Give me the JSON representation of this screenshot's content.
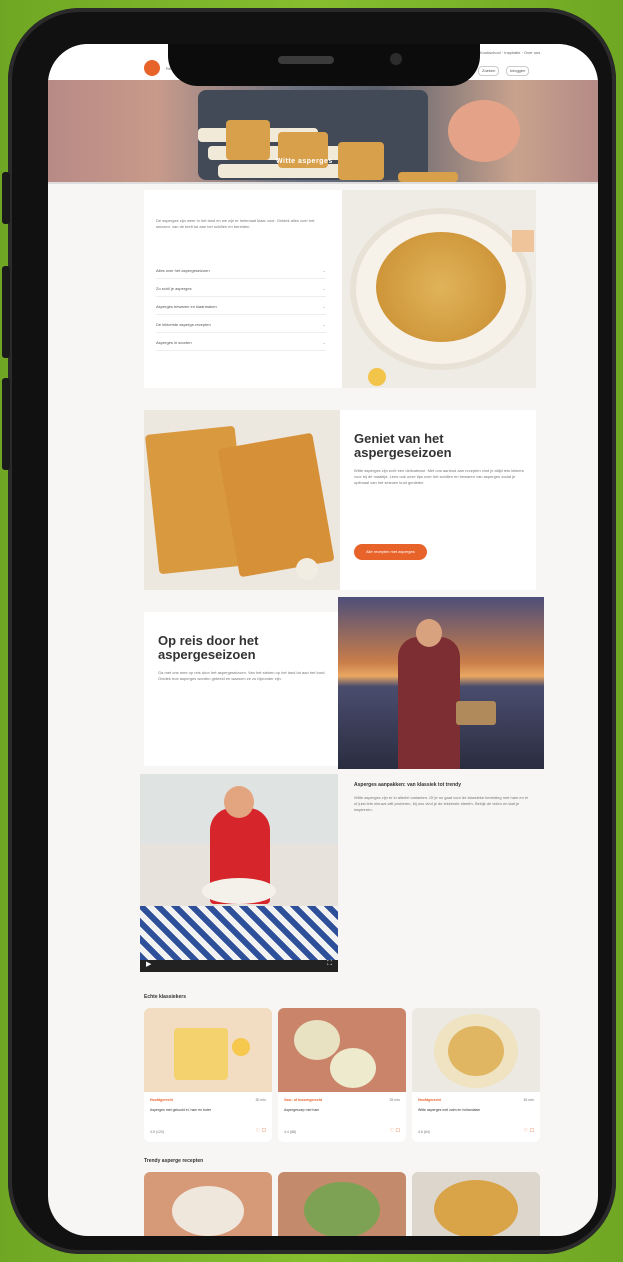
{
  "header": {
    "nav_left": "Recepten",
    "nav_right": "Kookschool · Inspiratie · Over ons",
    "search": "Zoeken",
    "account": "Inloggen"
  },
  "hero": {
    "title": "Witte asperges"
  },
  "intro": {
    "text": "De asperges zijn weer in het land en we zijn er helemaal klaar voor. Ontdek alles over het seizoen, van de teelt tot aan het schillen en bereiden.",
    "accordion": [
      "Alles over het aspergeseizoen",
      "Zo schil je asperges",
      "Asperges bewaren en klaarmaken",
      "De lekkerste asperge-recepten",
      "Asperges in soorten"
    ]
  },
  "section_geniet": {
    "title": "Geniet van het aspergeseizoen",
    "text": "Witte asperges zijn echt een delicatesse. Met ons aanbod aan recepten vind je altijd iets lekkers voor bij de maaltijd. Lees ook onze tips over het schillen en bewaren van asperges zodat je optimaal van het seizoen kunt genieten.",
    "button": "Alle recepten met asperges"
  },
  "section_reis": {
    "title": "Op reis door het aspergeseizoen",
    "text": "Ga met ons mee op reis door het aspergeseizoen. Van het steken op het land tot aan het bord. Ontdek hoe asperges worden geteeld en waarom ze zo bijzonder zijn."
  },
  "section_video": {
    "title": "Asperges aanpakken: van klassiek tot trendy",
    "text": "Witte asperges zijn er in allerlei varianten. Of je nu gaat voor de klassieke bereiding met ham en ei of juist iets nieuws wilt proberen, bij ons vind je de lekkerste ideeën. Bekijk de video en laat je inspireren."
  },
  "classics": {
    "title": "Echte klassiekers",
    "recipes": [
      {
        "tag": "Hoofdgerecht",
        "time": "30 min",
        "name": "Asperges met gekookt ei, ham en boter",
        "rating": "4.5 (120)"
      },
      {
        "tag": "Voor- of tussengerecht",
        "time": "25 min",
        "name": "Aspergesoep met ham",
        "rating": "4.4 (88)"
      },
      {
        "tag": "Hoofdgerecht",
        "time": "45 min",
        "name": "Witte asperges met zalm en hollandaise",
        "rating": "4.6 (64)"
      }
    ]
  },
  "trendy": {
    "title": "Trendy asperge recepten"
  }
}
